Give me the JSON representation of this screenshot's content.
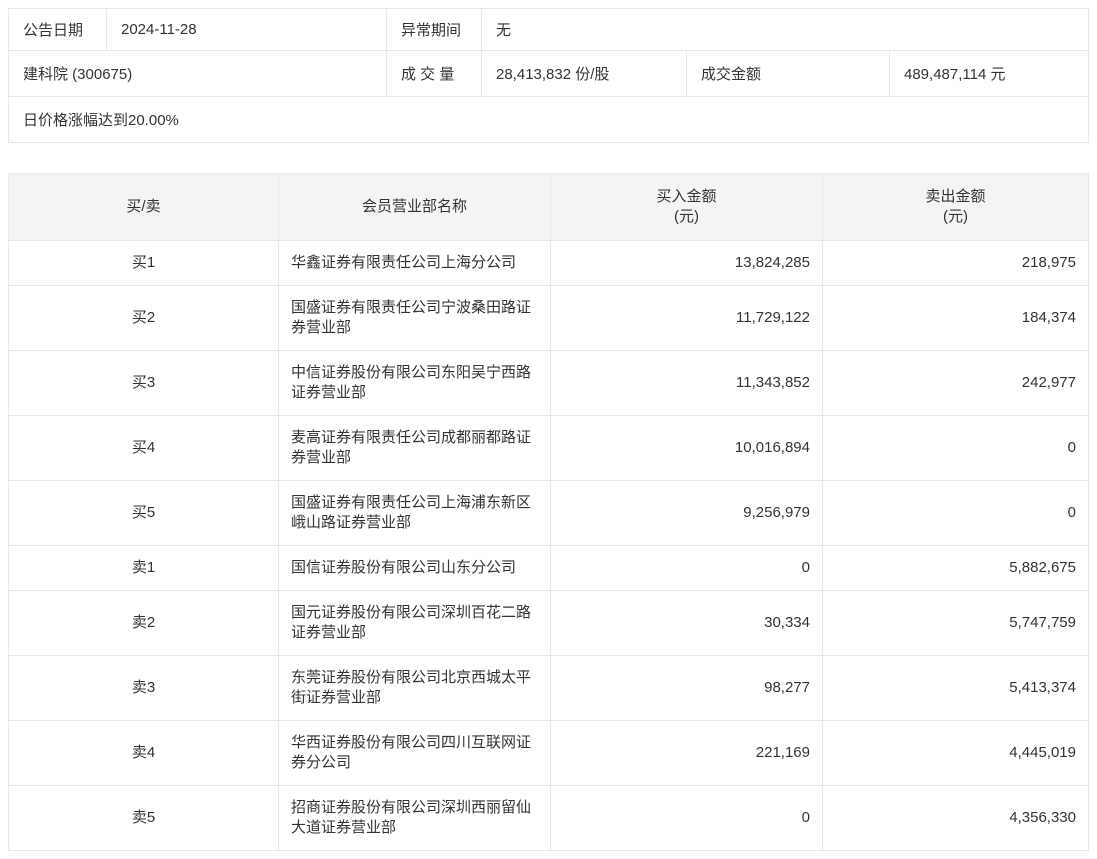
{
  "info": {
    "announce_label": "公告日期",
    "announce_date": "2024-11-28",
    "abnormal_label": "异常期间",
    "abnormal_value": "无",
    "stock": "建科院 (300675)",
    "volume_label": "成 交 量",
    "volume_value": "28,413,832 份/股",
    "turnover_label": "成交金额",
    "turnover_value": "489,487,114 元",
    "note": "日价格涨幅达到20.00%"
  },
  "table": {
    "headers": {
      "side": "买/卖",
      "branch": "会员营业部名称",
      "buy": "买入金额",
      "sell": "卖出金额",
      "unit": "(元)"
    },
    "rows": [
      {
        "side": "买1",
        "branch": "华鑫证券有限责任公司上海分公司",
        "buy": "13,824,285",
        "sell": "218,975"
      },
      {
        "side": "买2",
        "branch": "国盛证券有限责任公司宁波桑田路证券营业部",
        "buy": "11,729,122",
        "sell": "184,374"
      },
      {
        "side": "买3",
        "branch": "中信证券股份有限公司东阳吴宁西路证券营业部",
        "buy": "11,343,852",
        "sell": "242,977"
      },
      {
        "side": "买4",
        "branch": "麦高证券有限责任公司成都丽都路证券营业部",
        "buy": "10,016,894",
        "sell": "0"
      },
      {
        "side": "买5",
        "branch": "国盛证券有限责任公司上海浦东新区峨山路证券营业部",
        "buy": "9,256,979",
        "sell": "0"
      },
      {
        "side": "卖1",
        "branch": "国信证券股份有限公司山东分公司",
        "buy": "0",
        "sell": "5,882,675"
      },
      {
        "side": "卖2",
        "branch": "国元证券股份有限公司深圳百花二路证券营业部",
        "buy": "30,334",
        "sell": "5,747,759"
      },
      {
        "side": "卖3",
        "branch": "东莞证券股份有限公司北京西城太平街证券营业部",
        "buy": "98,277",
        "sell": "5,413,374"
      },
      {
        "side": "卖4",
        "branch": "华西证券股份有限公司四川互联网证券分公司",
        "buy": "221,169",
        "sell": "4,445,019"
      },
      {
        "side": "卖5",
        "branch": "招商证券股份有限公司深圳西丽留仙大道证券营业部",
        "buy": "0",
        "sell": "4,356,330"
      }
    ]
  }
}
